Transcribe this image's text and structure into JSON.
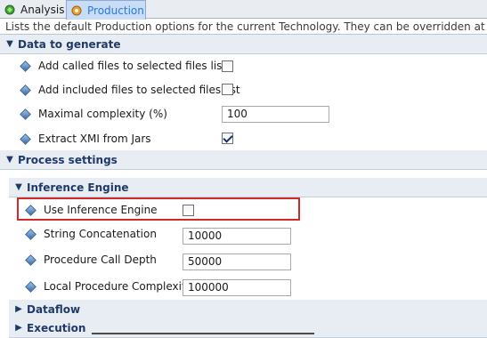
{
  "tabs": [
    {
      "label": "Analysis",
      "icon": "analysis-icon"
    },
    {
      "label": "Production",
      "icon": "production-icon",
      "selected": true
    }
  ],
  "description": "Lists the default Production options for the current Technology. They can be overridden at Application",
  "sections": {
    "data_to_generate": {
      "title": "Data to generate",
      "options": {
        "add_called": {
          "label": "Add called files to selected files list",
          "checked": false
        },
        "add_included": {
          "label": "Add included files to selected files list",
          "checked": false
        },
        "max_complexity": {
          "label": "Maximal complexity (%)",
          "value": "100"
        },
        "extract_xmi": {
          "label": "Extract XMI from Jars",
          "checked": true
        }
      }
    },
    "process_settings": {
      "title": "Process settings",
      "inference_engine": {
        "title": "Inference Engine",
        "options": {
          "use_inference": {
            "label": "Use Inference Engine",
            "checked": false
          },
          "string_concat": {
            "label": "String Concatenation",
            "value": "10000"
          },
          "call_depth": {
            "label": "Procedure Call Depth",
            "value": "50000"
          },
          "local_complexity": {
            "label": "Local Procedure Complexity",
            "value": "100000"
          }
        }
      },
      "dataflow": {
        "title": "Dataflow"
      },
      "execution": {
        "title": "Execution"
      }
    }
  },
  "colors": {
    "accent": "#2b7bd6",
    "highlight": "#d22a2a"
  }
}
